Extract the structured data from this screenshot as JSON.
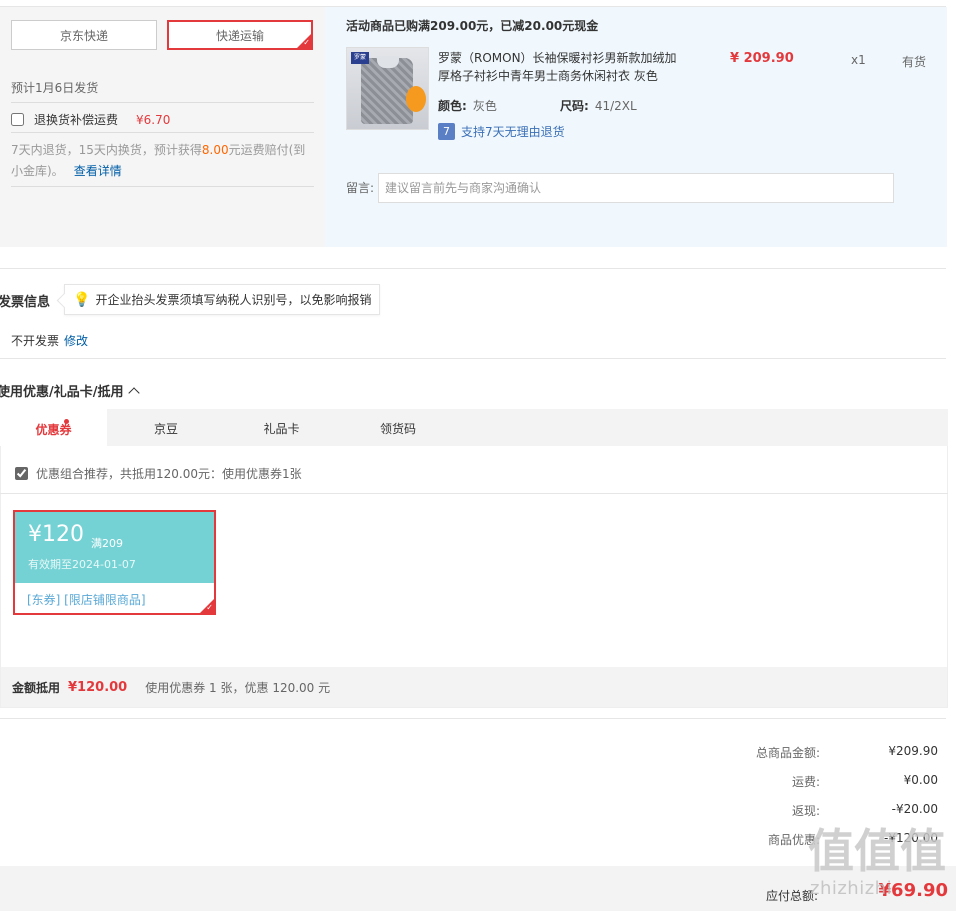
{
  "shipping": {
    "options": [
      "京东快递",
      "快递运输"
    ],
    "selected": "快递运输",
    "date": "预计1月6日发货",
    "insurance_label": "退换货补偿运费",
    "insurance_price": "¥6.70",
    "insurance_desc_prefix": "7天内退货，15天内换货，预计获得",
    "insurance_desc_amount": "8.00",
    "insurance_desc_suffix": "元运费赔付(到小金库)。",
    "insurance_link": "查看详情"
  },
  "product": {
    "promo_title": "活动商品已购满209.00元，已减20.00元现金",
    "image_badge": "罗蒙",
    "name": "罗蒙（ROMON）长袖保暖衬衫男新款加绒加厚格子衬衫中青年男士商务休闲衬衣 灰色",
    "price": "¥ 209.90",
    "qty": "x1",
    "stock": "有货",
    "color_label": "颜色:",
    "color_value": "灰色",
    "size_label": "尺码:",
    "size_value": "41/2XL",
    "return_icon": "7",
    "return_policy": "支持7天无理由退货",
    "message_label": "留言:",
    "message_placeholder": "建议留言前先与商家沟通确认"
  },
  "invoice": {
    "title": "发票信息",
    "tip": "开企业抬头发票须填写纳税人识别号，以免影响报销",
    "value": "不开发票",
    "edit": "修改"
  },
  "coupons": {
    "title": "使用优惠/礼品卡/抵用",
    "tabs": [
      "优惠券",
      "京豆",
      "礼品卡",
      "领货码"
    ],
    "active_tab": "优惠券",
    "combo_text": "优惠组合推荐，共抵用120.00元：使用优惠券1张",
    "card": {
      "amount": "¥120",
      "min": "满209",
      "expiry": "有效期至2024-01-07",
      "tags": "[东券]  [限店铺限商品]"
    },
    "summary_label": "金额抵用",
    "summary_amount": "¥120.00",
    "summary_desc": "使用优惠券 1 张，优惠 120.00 元"
  },
  "totals": {
    "rows": [
      {
        "label": "总商品金额:",
        "value": "¥209.90"
      },
      {
        "label": "运费:",
        "value": "¥0.00"
      },
      {
        "label": "返现:",
        "value": "-¥20.00"
      },
      {
        "label": "商品优惠:",
        "value": "-¥120.00"
      }
    ],
    "grand_label": "应付总额:",
    "grand_value": "¥69.90"
  },
  "watermark": {
    "glyphs": "值值值",
    "text": "zhizhizhi"
  },
  "colors": {
    "accent": "#e4393c",
    "coupon": "#74d2d4",
    "link": "#005ea7"
  }
}
